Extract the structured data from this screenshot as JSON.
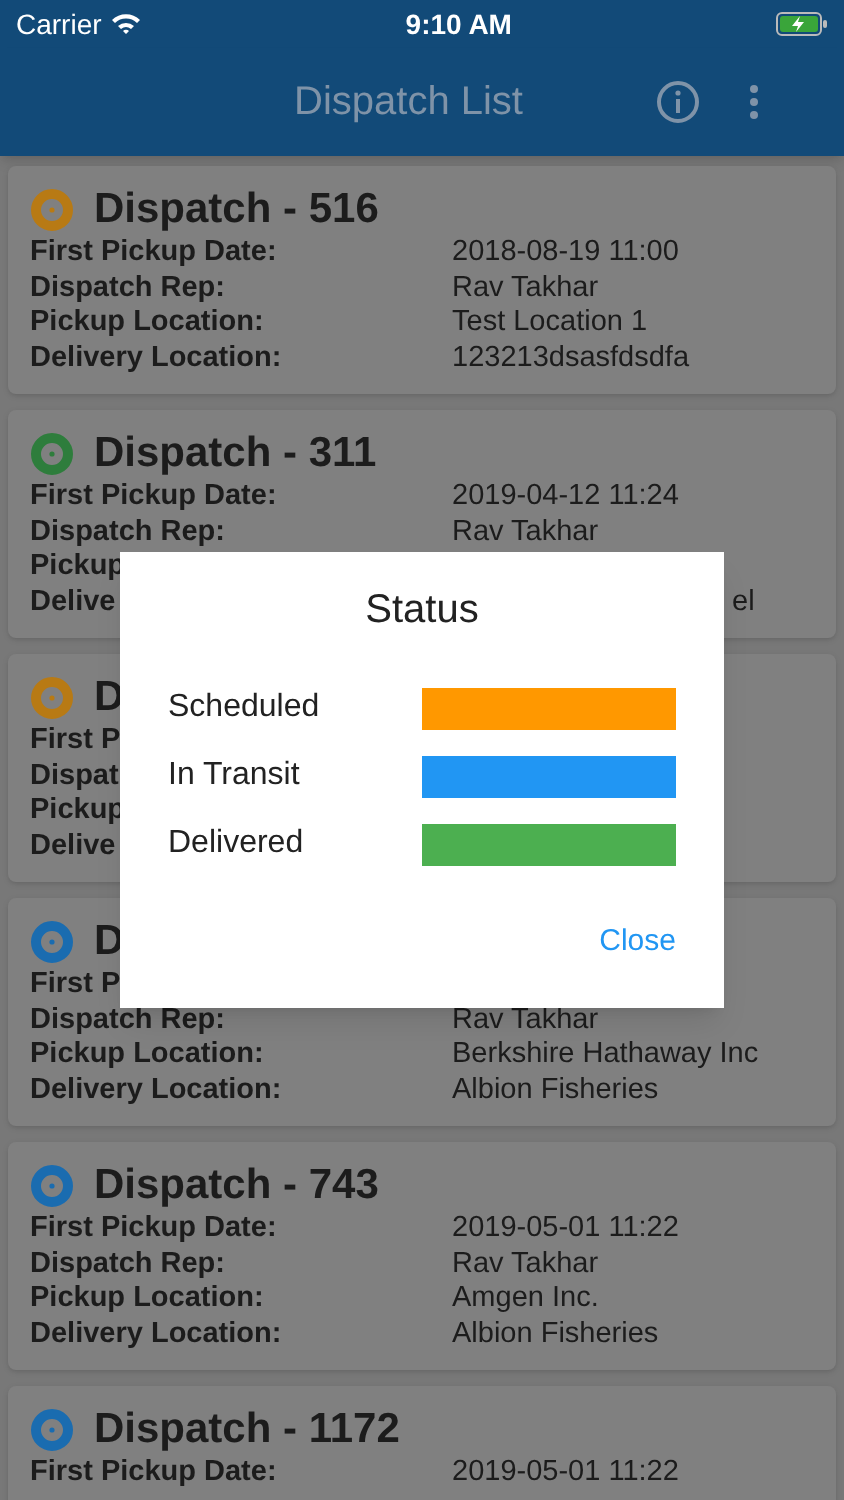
{
  "status_bar": {
    "carrier": "Carrier",
    "time": "9:10 AM"
  },
  "header": {
    "title": "Dispatch List"
  },
  "dispatches": [
    {
      "title": "Dispatch - 516",
      "color": "#b87a14",
      "rows": [
        {
          "label": "First Pickup Date:",
          "value": "2018-08-19 11:00"
        },
        {
          "label": "Dispatch Rep:",
          "value": "Rav Takhar"
        },
        {
          "label": "Pickup Location:",
          "value": "Test Location 1"
        },
        {
          "label": "Delivery Location:",
          "value": "123213dsasfdsdfa"
        }
      ]
    },
    {
      "title": "Dispatch - 311",
      "color": "#2e7d3c",
      "rows": [
        {
          "label": "First Pickup Date:",
          "value": "2019-04-12 11:24"
        },
        {
          "label": "Dispatch Rep:",
          "value": "Rav Takhar"
        },
        {
          "label": "Pickup"
        },
        {
          "label": "Delive",
          "value": "el",
          "value_offset": true
        }
      ]
    },
    {
      "title": "D",
      "color": "#b87a14",
      "rows": [
        {
          "label": "First P"
        },
        {
          "label": "Dispat"
        },
        {
          "label": "Pickup"
        },
        {
          "label": "Delive"
        }
      ]
    },
    {
      "title": "D",
      "color": "#1a6cb0",
      "rows": [
        {
          "label": "First P"
        },
        {
          "label": "Dispatch Rep:",
          "value": "Rav Takhar"
        },
        {
          "label": "Pickup Location:",
          "value": "Berkshire Hathaway Inc"
        },
        {
          "label": "Delivery Location:",
          "value": "Albion Fisheries"
        }
      ]
    },
    {
      "title": "Dispatch - 743",
      "color": "#1a6cb0",
      "rows": [
        {
          "label": "First Pickup Date:",
          "value": "2019-05-01 11:22"
        },
        {
          "label": "Dispatch Rep:",
          "value": "Rav Takhar"
        },
        {
          "label": "Pickup Location:",
          "value": "Amgen Inc."
        },
        {
          "label": "Delivery Location:",
          "value": "Albion Fisheries"
        }
      ]
    },
    {
      "title": "Dispatch - 1172",
      "color": "#1a6cb0",
      "rows": [
        {
          "label": "First Pickup Date:",
          "value": "2019-05-01 11:22"
        }
      ]
    }
  ],
  "dialog": {
    "title": "Status",
    "legend": [
      {
        "label": "Scheduled",
        "color": "#ff9800"
      },
      {
        "label": "In Transit",
        "color": "#2196f3"
      },
      {
        "label": "Delivered",
        "color": "#4caf50"
      }
    ],
    "close": "Close"
  }
}
